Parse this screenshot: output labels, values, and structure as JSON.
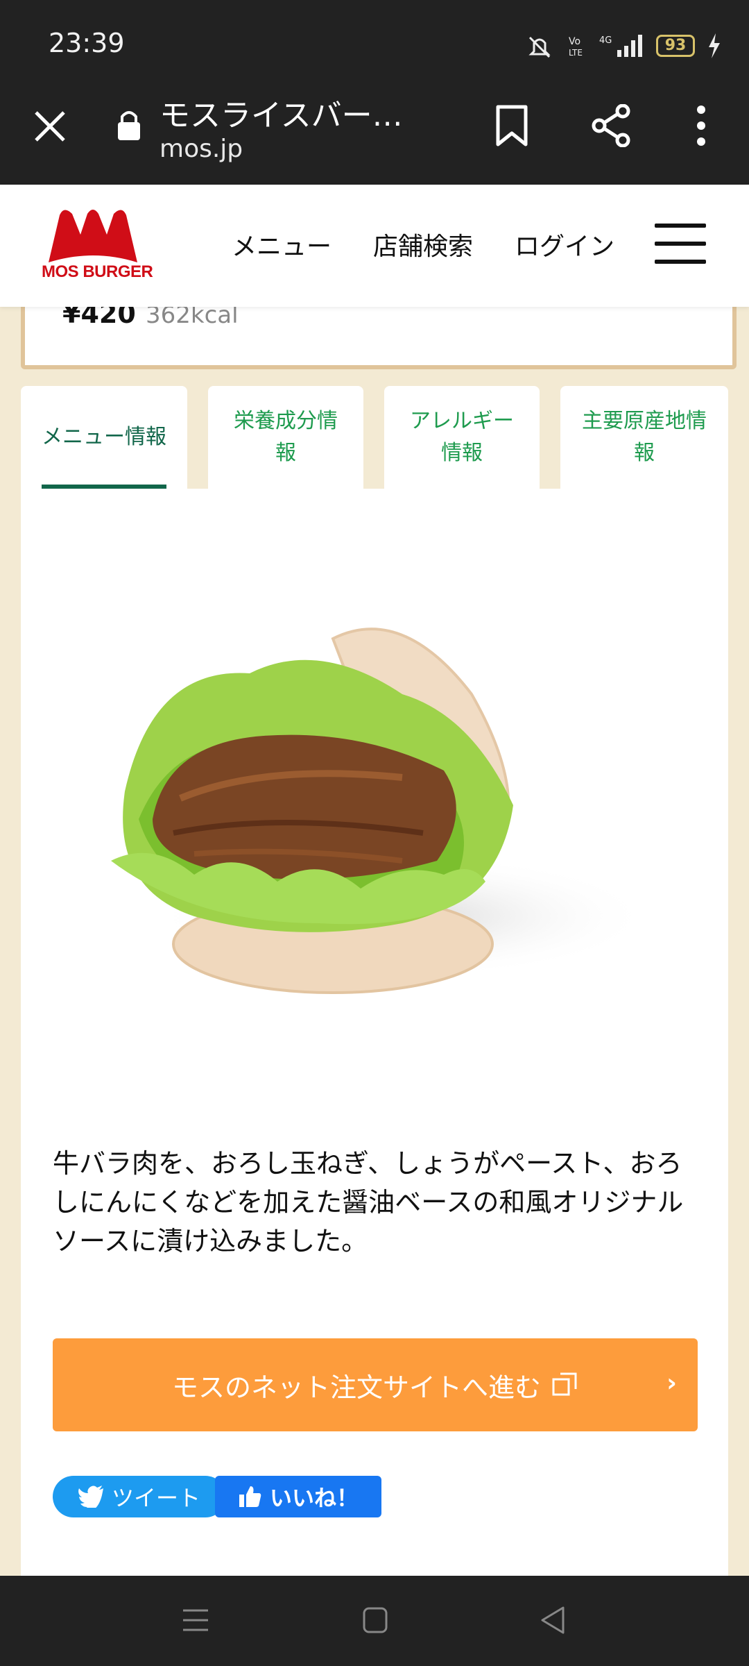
{
  "status_bar": {
    "time": "23:39",
    "battery": "93"
  },
  "browser": {
    "title": "モスライスバー…",
    "url": "mos.jp"
  },
  "site_header": {
    "logo_text": "MOS BURGER",
    "nav": [
      "メニュー",
      "店舗検索",
      "ログイン"
    ]
  },
  "product": {
    "price": "¥420",
    "kcal": "362kcal"
  },
  "tabs": [
    {
      "label": "メニュー情報"
    },
    {
      "label": "栄養成分情\n報"
    },
    {
      "label": "アレルギー\n情報"
    },
    {
      "label": "主要原産地情\n報"
    }
  ],
  "description": "牛バラ肉を、おろし玉ねぎ、しょうがペースト、おろしにんにくなどを加えた醤油ベースの和風オリジナルソースに漬け込みました。",
  "order_button": {
    "label": "モスのネット注文サイトへ進む",
    "arrow": "›"
  },
  "social": {
    "tweet": "ツイート",
    "like": "いいね！"
  },
  "colors": {
    "brand_red": "#d00d17",
    "tab_green": "#1e9b4e",
    "order_orange": "#fd9c3c",
    "twitter_blue": "#1d9bf0",
    "facebook_blue": "#1877f2"
  }
}
